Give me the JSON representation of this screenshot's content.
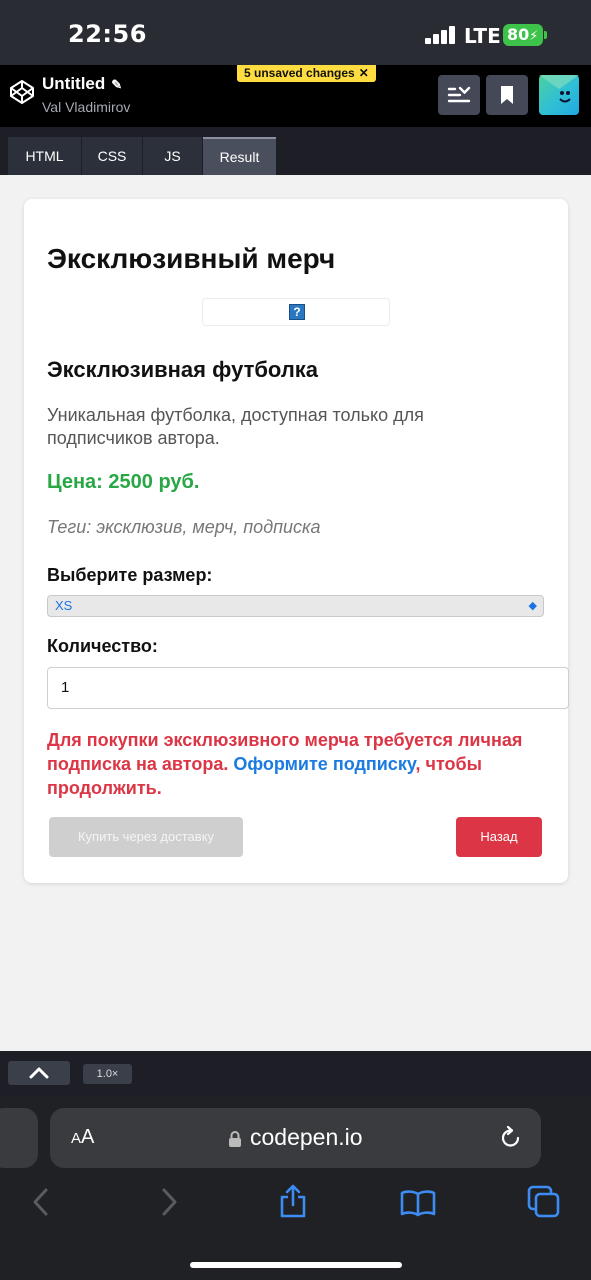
{
  "status_bar": {
    "time": "22:56",
    "network": "LTE",
    "battery": "80"
  },
  "header": {
    "title": "Untitled",
    "author": "Val Vladimirov",
    "unsaved_badge": "5 unsaved changes"
  },
  "editor_tabs": [
    {
      "label": "HTML",
      "active": false
    },
    {
      "label": "CSS",
      "active": false
    },
    {
      "label": "JS",
      "active": false
    },
    {
      "label": "Result",
      "active": true
    }
  ],
  "page": {
    "heading": "Эксклюзивный мерч",
    "product_title": "Эксклюзивная футболка",
    "description": "Уникальная футболка, доступная только для подписчиков автора.",
    "price": "Цена: 2500 руб.",
    "tags": "Теги: эксклюзив, мерч, подписка",
    "size_label": "Выберите размер:",
    "size_value": "XS",
    "qty_label": "Количество:",
    "qty_value": "1",
    "warning_before": "Для покупки эксклюзивного мерча требуется личная подписка на автора.",
    "warning_link": "Оформите подписку",
    "warning_after": ", чтобы продолжить.",
    "buy_button": "Купить через доставку",
    "back_button": "Назад"
  },
  "bottom_bar": {
    "zoom": "1.0×"
  },
  "browser": {
    "text_size": "AA",
    "url": "codepen.io"
  }
}
